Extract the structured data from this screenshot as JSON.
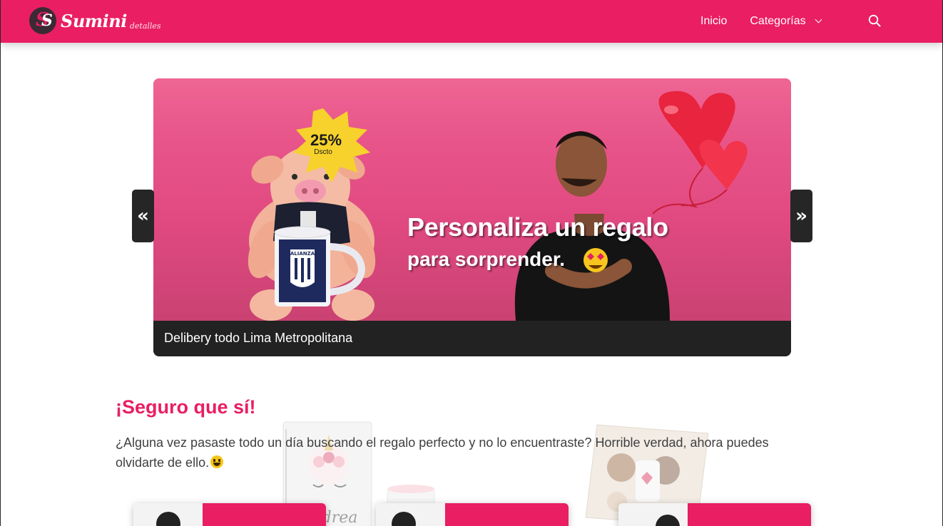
{
  "brand": {
    "name": "Sumini",
    "tagline": "detalles"
  },
  "nav": {
    "items": [
      {
        "label": "Inicio"
      },
      {
        "label": "Categorías"
      }
    ],
    "search_icon": "search-icon"
  },
  "slider": {
    "prev_label": "«",
    "next_label": "»",
    "badge_percent": "25%",
    "badge_text": "Dscto",
    "mug_text": "ALIANZA",
    "headline": "Personaliza un regalo",
    "subline": "para  sorprender.",
    "caption": "Delibery todo Lima Metropolitana"
  },
  "section": {
    "title": "¡Seguro que sí!",
    "text": "¿Alguna vez pasaste todo un día buscando el regalo perfecto y no lo encuentraste? Horrible verdad, ahora puedes olvidarte de ello."
  },
  "background_products": {
    "name_text": "Andrea"
  },
  "colors": {
    "brand": "#e91e63",
    "dark": "#222222"
  }
}
